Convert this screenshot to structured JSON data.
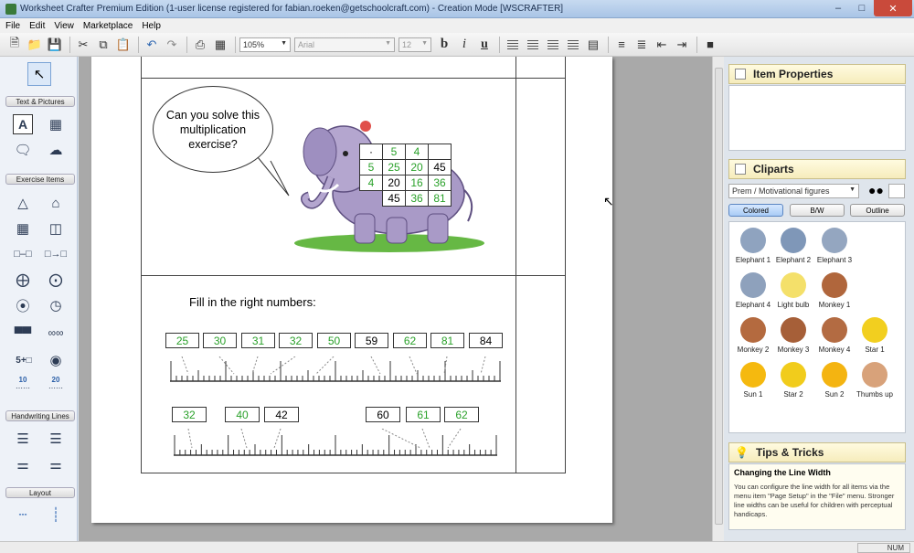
{
  "window": {
    "title": "Worksheet Crafter Premium Edition (1-user license registered for fabian.roeken@getschoolcraft.com) - Creation Mode [WSCRAFTER]"
  },
  "menu": [
    "File",
    "Edit",
    "View",
    "Marketplace",
    "Help"
  ],
  "toolbar": {
    "zoom": "105%",
    "font": "Arial",
    "font_size": "12",
    "bold": "b",
    "italic": "i",
    "underline": "u"
  },
  "left_panel": {
    "sections": {
      "text_pictures": "Text & Pictures",
      "exercise_items": "Exercise Items",
      "handwriting_lines": "Handwriting Lines",
      "layout": "Layout"
    },
    "counters": [
      "10",
      "20"
    ],
    "math_label": "5+□"
  },
  "worksheet": {
    "bubble_text": "Can you solve this multiplication exercise?",
    "grid": {
      "rows": [
        [
          "·",
          "5",
          "4",
          ""
        ],
        [
          "5",
          "25",
          "20",
          "45"
        ],
        [
          "4",
          "20",
          "16",
          "36"
        ],
        [
          "",
          "45",
          "36",
          "81"
        ]
      ]
    },
    "instruction": "Fill in the right numbers:",
    "row1": [
      {
        "v": "25",
        "given": false
      },
      {
        "v": "30",
        "given": false
      },
      {
        "v": "31",
        "given": false
      },
      {
        "v": "32",
        "given": false
      },
      {
        "v": "50",
        "given": false
      },
      {
        "v": "59",
        "given": true
      },
      {
        "v": "62",
        "given": false
      },
      {
        "v": "81",
        "given": false
      },
      {
        "v": "84",
        "given": true
      }
    ],
    "row2": [
      {
        "v": "32",
        "given": false
      },
      {
        "v": "40",
        "given": false
      },
      {
        "v": "42",
        "given": true
      },
      {
        "v": "60",
        "given": true
      },
      {
        "v": "61",
        "given": false
      },
      {
        "v": "62",
        "given": false
      }
    ]
  },
  "right_panel": {
    "item_properties": "Item Properties",
    "cliparts": "Cliparts",
    "category": "Prem / Motivational figures",
    "filters": [
      "Colored",
      "B/W",
      "Outline"
    ],
    "items": [
      {
        "name": "Elephant 1",
        "color": "#8fa3bf"
      },
      {
        "name": "Elephant 2",
        "color": "#7f97b8"
      },
      {
        "name": "Elephant 3",
        "color": "#94a6c0"
      },
      {
        "name": "Elephant 4",
        "color": "#8ea1bc"
      },
      {
        "name": "Light bulb",
        "color": "#f4e06a"
      },
      {
        "name": "Monkey 1",
        "color": "#b0663c"
      },
      {
        "name": "Monkey 2",
        "color": "#b46a3f"
      },
      {
        "name": "Monkey 3",
        "color": "#a65f38"
      },
      {
        "name": "Monkey 4",
        "color": "#b36b42"
      },
      {
        "name": "Star 1",
        "color": "#f2cf1f"
      },
      {
        "name": "Sun 1",
        "color": "#f5b90f"
      },
      {
        "name": "Star 2",
        "color": "#f1cc1c"
      },
      {
        "name": "Sun 2",
        "color": "#f4b411"
      },
      {
        "name": "Thumbs up",
        "color": "#d8a27a"
      }
    ],
    "tips": {
      "title": "Tips & Tricks",
      "subtitle": "Changing the Line Width",
      "body": "You can configure the line width for all items via the menu item \"Page Setup\" in the \"File\" menu. Stronger line widths can be useful for children with perceptual handicaps."
    }
  },
  "status": {
    "num": "NUM"
  }
}
